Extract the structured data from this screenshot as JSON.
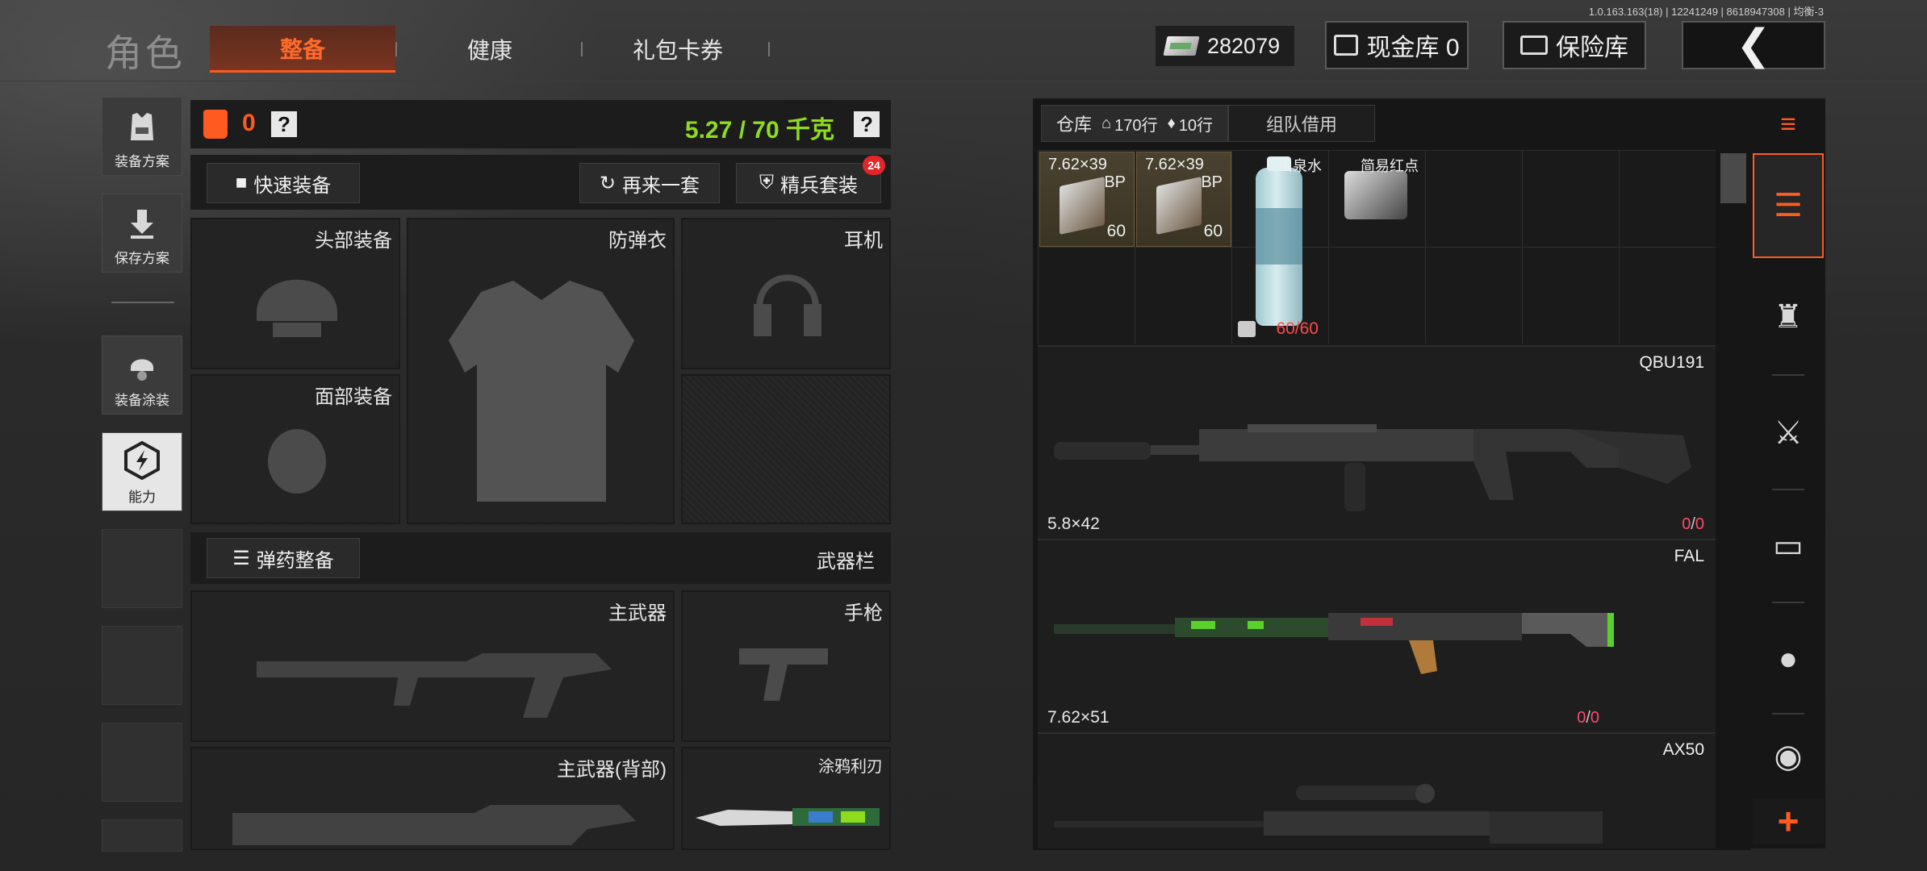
{
  "app": {
    "version": "1.0.163.163(18) | 12241249 | 8618947308 | 均衡-3",
    "title": "角色"
  },
  "tabs": [
    {
      "label": "整备",
      "active": true
    },
    {
      "label": "健康",
      "active": false
    },
    {
      "label": "礼包卡券",
      "active": false
    }
  ],
  "currency": {
    "amount": "282079"
  },
  "top_buttons": {
    "cash_vault": "现金库 0",
    "insurance_vault": "保险库"
  },
  "sidebar": {
    "items": [
      {
        "label": "装备方案",
        "icon": "vest-icon"
      },
      {
        "label": "保存方案",
        "icon": "download-icon"
      },
      {
        "label": "装备涂装",
        "icon": "helmet-paint-icon"
      },
      {
        "label": "能力",
        "icon": "lightning-hex-icon"
      }
    ]
  },
  "loadout": {
    "armor_count": "0",
    "help_mark": "?",
    "weight": "5.27 / 70 千克",
    "quick_equip": "快速装备",
    "repeat_set": "再来一套",
    "elite_set": "精兵套装",
    "elite_badge": "24",
    "slots": {
      "head": "头部装备",
      "vest": "防弹衣",
      "headset": "耳机",
      "face": "面部装备",
      "primary": "主武器",
      "pistol": "手枪",
      "primary_back": "主武器(背部)",
      "melee": "涂鸦利刃"
    },
    "ammo_loadout": "弹药整备",
    "weapon_bar": "武器栏"
  },
  "warehouse": {
    "tab_label": "仓库",
    "rows_home": "170行",
    "rows_tag": "10行",
    "team_borrow": "组队借用",
    "items": [
      {
        "name": "7.62×39",
        "tag": "BP",
        "count": "60"
      },
      {
        "name": "7.62×39",
        "tag": "BP",
        "count": "60"
      },
      {
        "name": "山泉水",
        "count": "60/60"
      },
      {
        "name": "简易红点"
      }
    ],
    "weapons": [
      {
        "name": "QBU191",
        "caliber": "5.8×42",
        "durability_a": "0",
        "durability_b": "0"
      },
      {
        "name": "FAL",
        "caliber": "7.62×51",
        "durability_a": "0",
        "durability_b": "0"
      },
      {
        "name": "AX50"
      }
    ]
  },
  "rail": {
    "items": [
      "stack-refresh-icon",
      "stack-download-icon",
      "armor-icon",
      "rifle-icon",
      "magazine-icon",
      "bullet-icon",
      "sight-icon"
    ],
    "plus": "+"
  },
  "colors": {
    "accent": "#ff5a1f",
    "weight_green": "#8fdc1e",
    "warn_red": "#ff4a4a"
  }
}
